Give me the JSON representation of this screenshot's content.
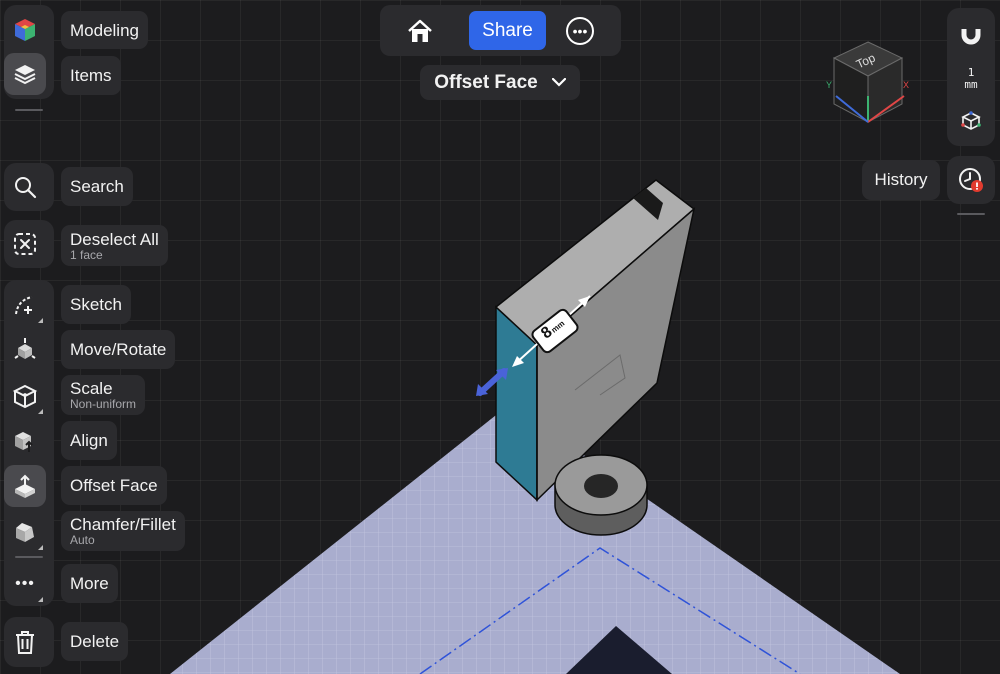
{
  "top_bar": {
    "share_label": "Share"
  },
  "mode_dropdown": {
    "label": "Offset Face"
  },
  "left_toolbar": {
    "modeling": "Modeling",
    "items": "Items",
    "search": "Search",
    "deselect_all": "Deselect All",
    "deselect_sub": "1 face",
    "sketch": "Sketch",
    "move_rotate": "Move/Rotate",
    "scale": "Scale",
    "scale_sub": "Non-uniform",
    "align": "Align",
    "offset_face": "Offset Face",
    "chamfer_fillet": "Chamfer/Fillet",
    "chamfer_sub": "Auto",
    "more": "More",
    "delete": "Delete"
  },
  "right_panel": {
    "units_value": "1",
    "units_label": "mm",
    "history_label": "History"
  },
  "view_cube": {
    "face_top": "Top",
    "axis_x": "X",
    "axis_y": "Y"
  },
  "dimension": {
    "value": "8",
    "unit": "mm"
  },
  "colors": {
    "accent": "#2f66e8",
    "selected_face": "#2e7b94",
    "floor": "#a9adce",
    "panel": "#2b2b2e",
    "background": "#1c1c1e"
  }
}
